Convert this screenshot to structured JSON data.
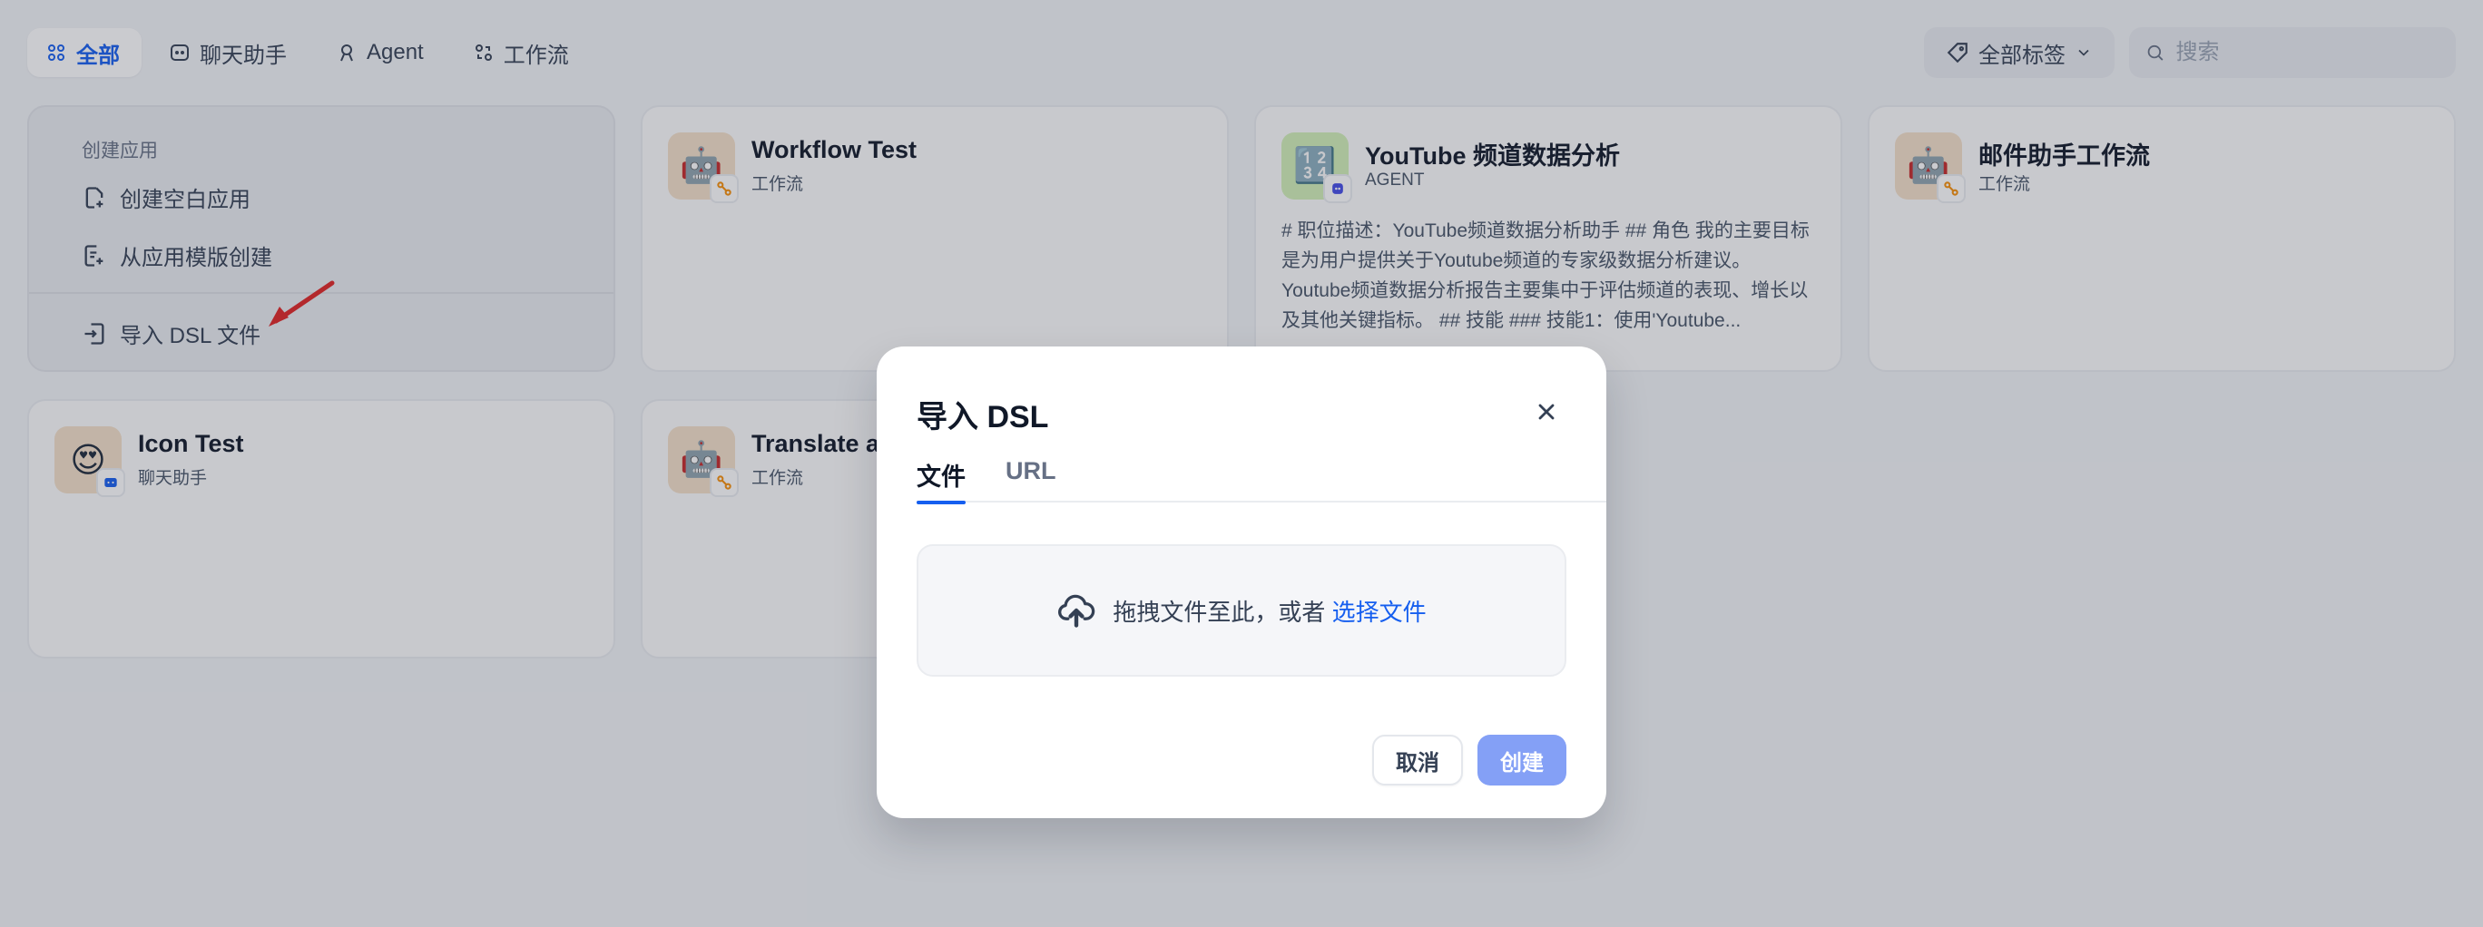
{
  "nav": {
    "tabs": [
      {
        "label": "全部",
        "icon": "grid-icon",
        "active": true
      },
      {
        "label": "聊天助手",
        "icon": "chat-icon",
        "active": false
      },
      {
        "label": "Agent",
        "icon": "agent-icon",
        "active": false
      },
      {
        "label": "工作流",
        "icon": "workflow-icon",
        "active": false
      }
    ],
    "tag_filter": "全部标签",
    "search_placeholder": "搜索"
  },
  "create_card": {
    "header": "创建应用",
    "items": [
      {
        "label": "创建空白应用",
        "icon": "file-plus-icon"
      },
      {
        "label": "从应用模版创建",
        "icon": "file-template-icon"
      },
      {
        "label": "导入 DSL 文件",
        "icon": "file-import-icon"
      }
    ]
  },
  "apps": [
    {
      "name": "Workflow Test",
      "type": "工作流",
      "icon": "robot-icon",
      "icon_glyph": "🤖",
      "desc": ""
    },
    {
      "name": "YouTube 频道数据分析",
      "type": "AGENT",
      "icon": "number-tiles-icon",
      "icon_glyph": "🔢",
      "desc": "# 职位描述：YouTube频道数据分析助手 ## 角色 我的主要目标是为用户提供关于Youtube频道的专家级数据分析建议。Youtube频道数据分析报告主要集中于评估频道的表现、增长以及其他关键指标。 ## 技能 ### 技能1：使用'Youtube..."
    },
    {
      "name": "邮件助手工作流",
      "type": "工作流",
      "icon": "robot-icon",
      "icon_glyph": "🤖",
      "desc": ""
    },
    {
      "name": "Icon Test",
      "type": "聊天助手",
      "icon": "heart-eyes-icon",
      "icon_glyph": "😍",
      "desc": ""
    },
    {
      "name": "Translate a",
      "type": "工作流",
      "icon": "robot-icon",
      "icon_glyph": "🤖",
      "desc": ""
    }
  ],
  "modal": {
    "title": "导入 DSL",
    "tabs": [
      "文件",
      "URL"
    ],
    "drop_text": "拖拽文件至此，或者",
    "drop_link": "选择文件",
    "cancel": "取消",
    "create": "创建"
  },
  "colors": {
    "accent": "#155eef",
    "create_disabled": "#84a0f6"
  }
}
